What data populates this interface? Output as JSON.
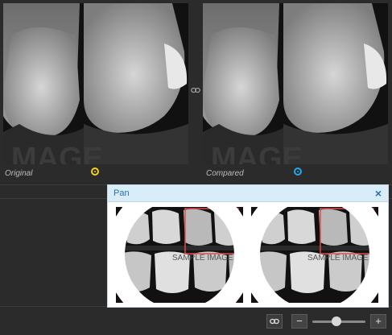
{
  "panels": {
    "left": {
      "caption": "Original",
      "marker_color": "#f2d21b"
    },
    "right": {
      "caption": "Compared",
      "marker_color": "#22a7ee"
    },
    "watermark": "MAGE"
  },
  "sync_icon": "link-icon",
  "pan_window": {
    "title": "Pan",
    "close_label": "×",
    "thumbnail_watermark": "SAMPLE IMAGE",
    "viewport_color": "#e24a4a"
  },
  "toolbar": {
    "link_icon": "link-icon",
    "zoom_out_label": "−",
    "zoom_in_label": "+",
    "zoom_level": 0.45
  }
}
